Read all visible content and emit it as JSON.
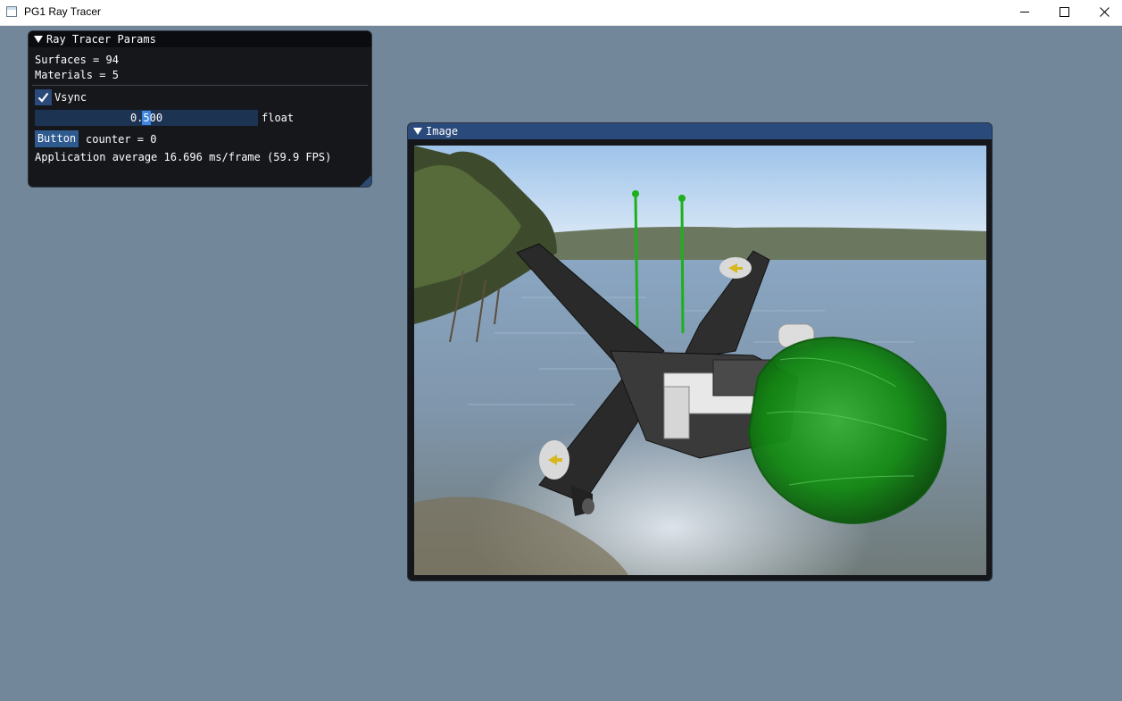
{
  "app": {
    "title": "PG1 Ray Tracer"
  },
  "params_window": {
    "title": "Ray Tracer Params",
    "surfaces_text": "Surfaces = 94",
    "materials_text": "Materials = 5",
    "vsync": {
      "label": "Vsync",
      "checked": true
    },
    "slider": {
      "value": "0.500",
      "fraction": 0.5,
      "label": "float"
    },
    "button_label": "Button",
    "counter_text": "counter = 0",
    "fps_text": "Application average 16.696 ms/frame (59.9 FPS)"
  },
  "image_window": {
    "title": "Image"
  },
  "colors": {
    "background": "#72889a",
    "imgui_accent": "#294a7a",
    "imgui_window": "#15171b"
  },
  "icons": [
    "app-icon",
    "minimize-icon",
    "maximize-icon",
    "close-icon",
    "collapse-arrow-icon",
    "checkmark-icon",
    "resize-grip-icon"
  ]
}
